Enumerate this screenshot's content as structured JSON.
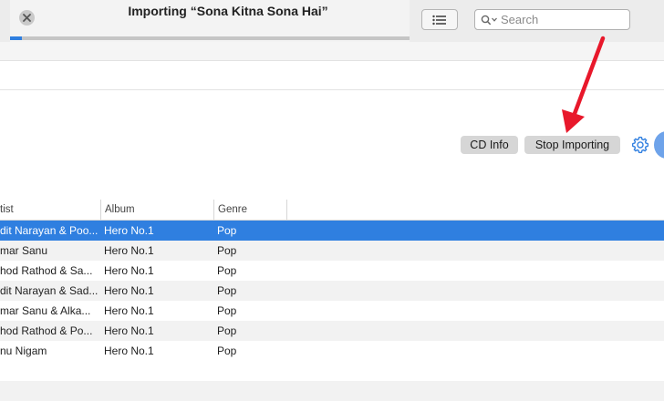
{
  "window": {
    "title": "Importing “Sona Kitna Sona Hai”",
    "import_progress": 0.03
  },
  "search": {
    "placeholder": "Search",
    "value": ""
  },
  "actions": {
    "cd_info_label": "CD Info",
    "stop_importing_label": "Stop Importing"
  },
  "colors": {
    "accent": "#2f7fe0",
    "annotation_arrow": "#e8182b"
  },
  "icons": {
    "close": "close-icon",
    "list": "list-view-icon",
    "search": "search-icon",
    "settings": "gear-icon"
  },
  "table": {
    "columns": [
      "tist",
      "Album",
      "Genre"
    ],
    "rows": [
      {
        "artist": "dit Narayan & Poo...",
        "album": "Hero No.1",
        "genre": "Pop",
        "selected": true
      },
      {
        "artist": "mar Sanu",
        "album": "Hero No.1",
        "genre": "Pop",
        "selected": false
      },
      {
        "artist": "hod Rathod & Sa...",
        "album": "Hero No.1",
        "genre": "Pop",
        "selected": false
      },
      {
        "artist": "dit Narayan & Sad...",
        "album": "Hero No.1",
        "genre": "Pop",
        "selected": false
      },
      {
        "artist": "mar Sanu & Alka...",
        "album": "Hero No.1",
        "genre": "Pop",
        "selected": false
      },
      {
        "artist": "hod Rathod & Po...",
        "album": "Hero No.1",
        "genre": "Pop",
        "selected": false
      },
      {
        "artist": "nu Nigam",
        "album": "Hero No.1",
        "genre": "Pop",
        "selected": false
      }
    ]
  }
}
